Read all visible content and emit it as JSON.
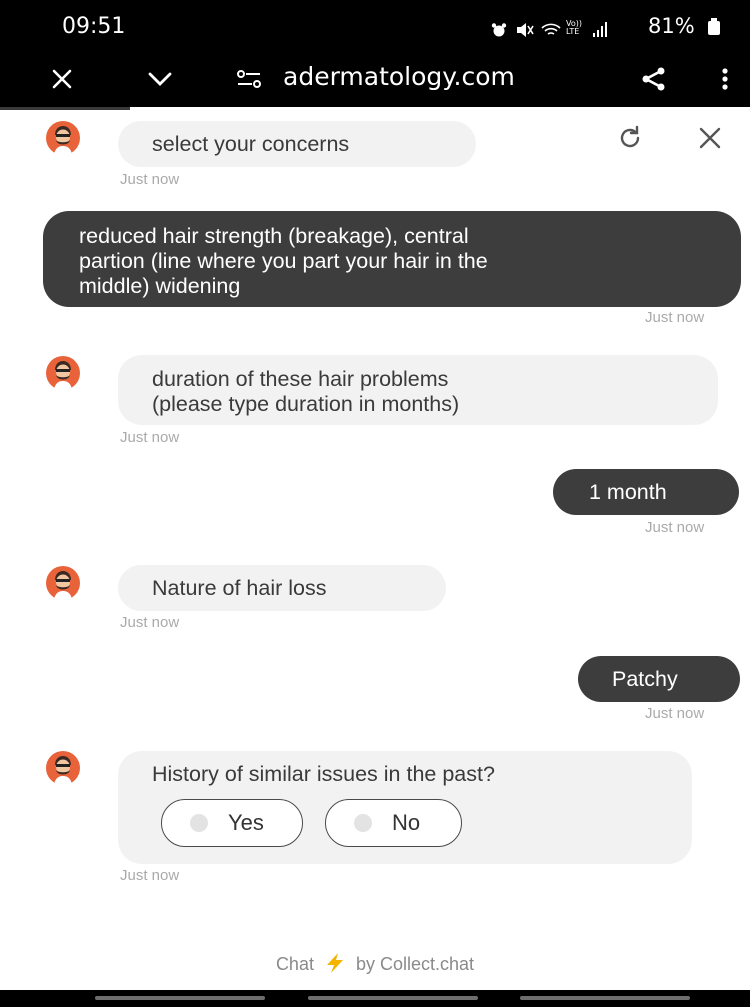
{
  "status_bar": {
    "time": "09:51",
    "icons": [
      "alarm-icon",
      "mute-icon",
      "wifi-icon",
      "volte-icon",
      "signal-icon"
    ],
    "volte_text": "Vo)) LTE",
    "battery": "81%"
  },
  "browser": {
    "url": "adermatology.com",
    "icons": [
      "close-icon",
      "chevron-down-icon",
      "site-settings-icon",
      "share-icon",
      "more-icon"
    ]
  },
  "chat": {
    "header_actions": [
      "refresh-icon",
      "close-icon"
    ],
    "messages": [
      {
        "from": "bot",
        "text": "select your concerns",
        "time": "Just now"
      },
      {
        "from": "user",
        "lines": [
          "reduced hair strength (breakage), central",
          "partion (line where you part your hair in the",
          "middle) widening"
        ],
        "time": "Just now"
      },
      {
        "from": "bot",
        "lines": [
          "duration of these hair problems",
          "(please type duration in months)"
        ],
        "time": "Just now"
      },
      {
        "from": "user",
        "text": "1 month",
        "time": "Just now"
      },
      {
        "from": "bot",
        "text": "Nature of hair loss",
        "time": "Just now"
      },
      {
        "from": "user",
        "text": "Patchy",
        "time": "Just now"
      },
      {
        "from": "bot",
        "text": "History of similar issues in the past?",
        "time": "Just now",
        "options": [
          "Yes",
          "No"
        ]
      }
    ]
  },
  "footer": {
    "prefix": "Chat",
    "suffix": "by Collect.chat",
    "accent": "#f5b400"
  },
  "colors": {
    "avatar_bg": "#e8623a",
    "user_bubble": "#3d3d3d",
    "bot_bubble": "#f2f2f2"
  }
}
